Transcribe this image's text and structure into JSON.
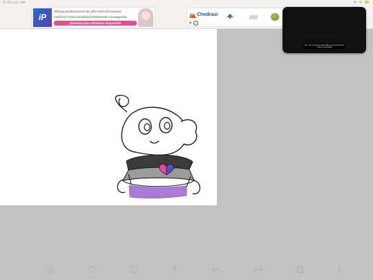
{
  "status_bar": {
    "time": "11:55 a.m.",
    "date": "mié"
  },
  "top_ad": {
    "logo_text": "iP",
    "line1": "¡Dibuja ilustraciones de alto nivel de manera",
    "line2": "intuitiva! ¡Funcionalidad totalmente conseguida!",
    "cta": "¡ibisPaint para Windows disponible!"
  },
  "right_ad": {
    "brand": "Chedraui",
    "close_symbol": "✕",
    "info_symbol": "i"
  },
  "video": {
    "caption": "So, you're just gonna walk up and ask them how it's spelled?"
  },
  "colors": {
    "background": "#c2c2c2",
    "canvas": "#ffffff",
    "shirt_dark": "#3b3b3b",
    "shirt_mid": "#9b9b9b",
    "pants": "#a77bd6",
    "heart_left": "#ff3f95",
    "heart_right": "#4a53c8"
  },
  "toolbar": {
    "icons": [
      "transform-icon",
      "lasso-icon",
      "layer-square-icon",
      "move-arrow-icon",
      "undo-icon",
      "redo-icon",
      "layers-icon",
      "back-chevron-icon"
    ]
  }
}
